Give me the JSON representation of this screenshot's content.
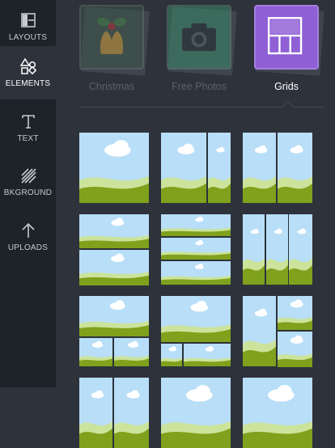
{
  "sidebar": {
    "items": [
      {
        "key": "layouts",
        "label": "LAYOUTS",
        "icon": "layouts-icon"
      },
      {
        "key": "elements",
        "label": "ELEMENTS",
        "icon": "shapes-icon",
        "active": true
      },
      {
        "key": "text",
        "label": "TEXT",
        "icon": "text-icon"
      },
      {
        "key": "bkground",
        "label": "BKGROUND",
        "icon": "background-hatch-icon"
      },
      {
        "key": "uploads",
        "label": "UPLOADS",
        "icon": "upload-arrow-icon"
      }
    ]
  },
  "categories": [
    {
      "label": "Christmas",
      "icon": "christmas-bells-icon"
    },
    {
      "label": "Free Photos",
      "icon": "camera-icon"
    },
    {
      "label": "Grids",
      "icon": "grid-layout-icon",
      "active": true
    }
  ],
  "colors": {
    "sidebar_bg": "#1e2329",
    "panel_bg": "#2d323b",
    "grids_accent": "#8f5fd6",
    "sky": "#b8def8",
    "hill_light": "#cbe39a",
    "hill_dark": "#7fa11c"
  },
  "grid_thumbnail_count": 12
}
